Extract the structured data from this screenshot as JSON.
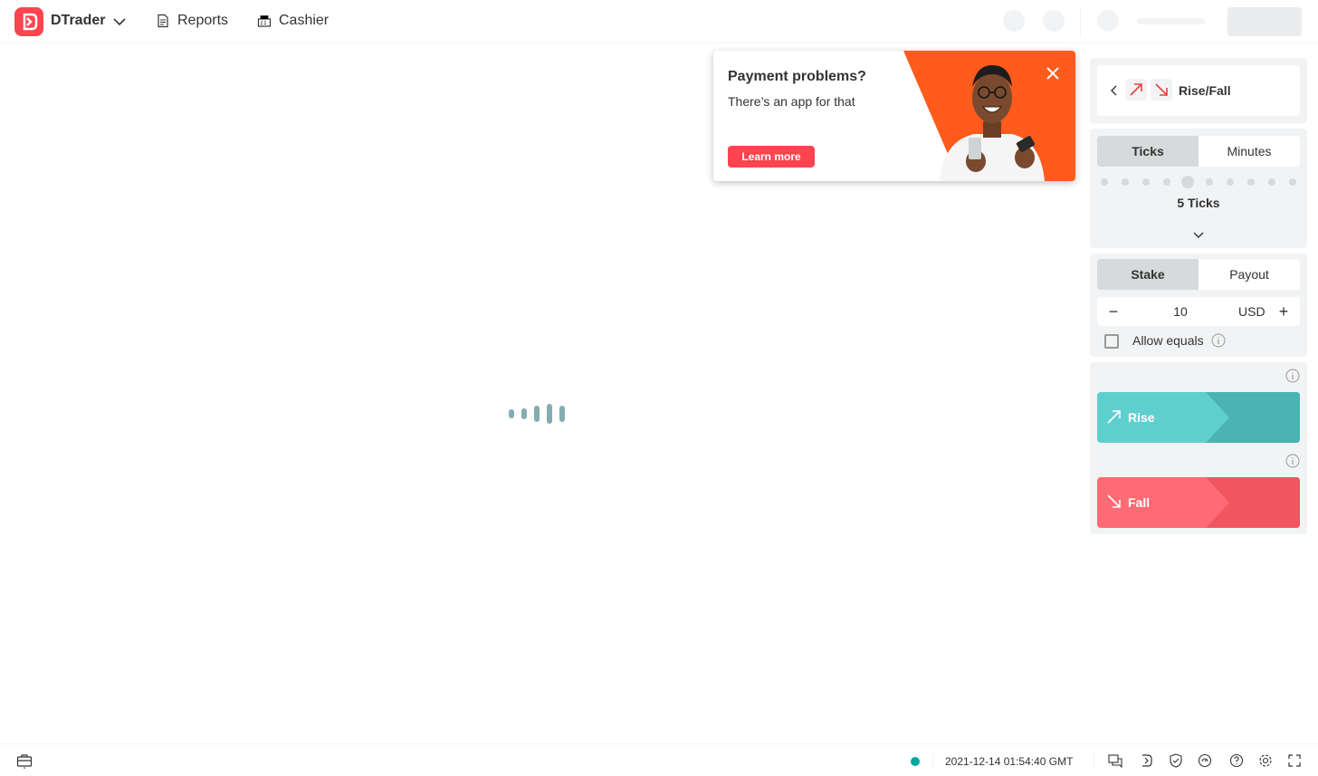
{
  "header": {
    "app_name": "DTrader",
    "nav": [
      {
        "label": "Reports",
        "icon": "reports-icon"
      },
      {
        "label": "Cashier",
        "icon": "cashier-icon"
      }
    ]
  },
  "banner": {
    "title": "Payment problems?",
    "subtitle": "There’s an app for that",
    "button_label": "Learn more"
  },
  "trade": {
    "contract_type": "Rise/Fall",
    "duration": {
      "tabs": [
        "Ticks",
        "Minutes"
      ],
      "active_tab": "Ticks",
      "selected_label": "5 Ticks",
      "selected_value": 5,
      "max_ticks": 10
    },
    "amount": {
      "tabs": [
        "Stake",
        "Payout"
      ],
      "active_tab": "Stake",
      "value": "10",
      "currency": "USD"
    },
    "allow_equals": {
      "label": "Allow equals",
      "checked": false
    },
    "purchase": {
      "rise_label": "Rise",
      "fall_label": "Fall"
    }
  },
  "footer": {
    "server_time": "2021-12-14 01:54:40 GMT"
  },
  "colors": {
    "brand": "#ff444f",
    "rise": "#4bb4b3",
    "fall": "#ec3f3f",
    "status": "#00a79e"
  }
}
